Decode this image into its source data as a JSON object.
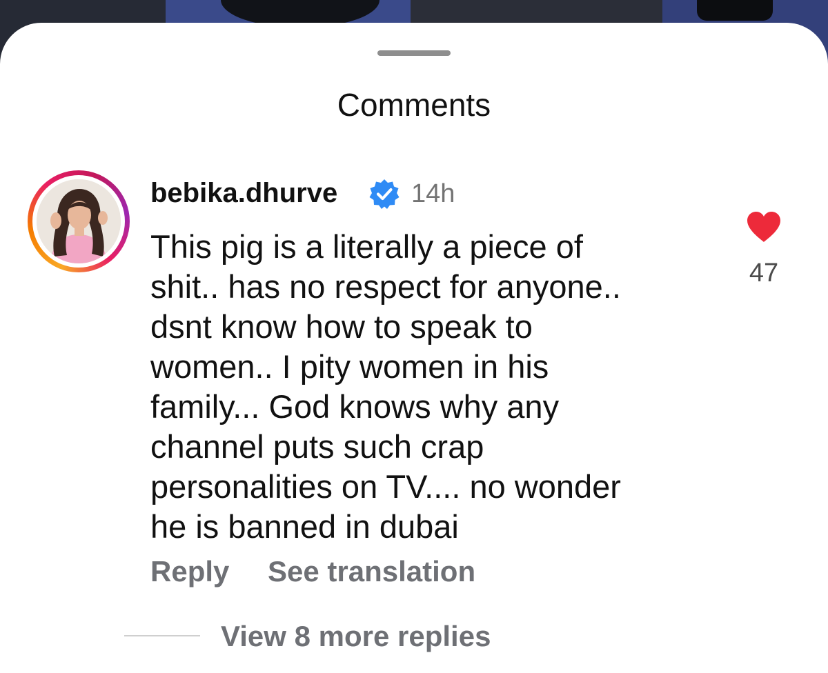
{
  "sheet": {
    "title": "Comments"
  },
  "comment": {
    "username": "bebika.dhurve",
    "verified": true,
    "time": "14h",
    "text_lines": [
      "This pig is a literally a piece of",
      "shit.. has no respect for anyone..",
      "dsnt know how to speak to",
      "women.. I pity women in his",
      "family... God knows why any",
      "channel puts such crap",
      "personalities on TV.... no wonder",
      "he is banned in dubai"
    ],
    "like_count": "47",
    "liked": true,
    "reply_label": "Reply",
    "see_translation_label": "See translation",
    "view_replies_label": "View 8 more replies"
  },
  "colors": {
    "like": "#ed2a3a",
    "verified_badge": "#2f8bf5",
    "secondary_text": "#6e7075"
  },
  "icons": {
    "verified": "verified-badge-icon",
    "like": "heart-filled-icon"
  }
}
